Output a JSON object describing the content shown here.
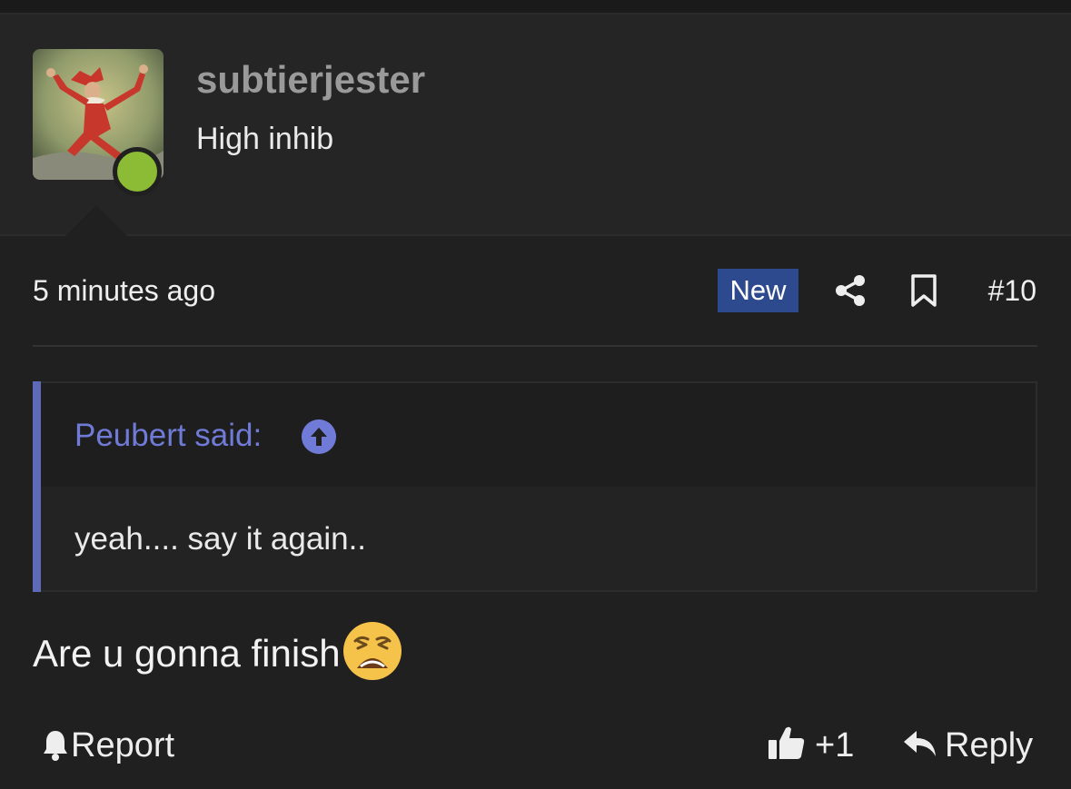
{
  "post": {
    "author": "subtierjester",
    "user_title": "High inhib",
    "timestamp": "5 minutes ago",
    "badge": "New",
    "post_number": "#10",
    "online_status_color": "#8cbb35"
  },
  "quote": {
    "author_line": "Peubert said:",
    "text": "yeah.... say it again.."
  },
  "message": {
    "text": "Are u gonna finish",
    "emoji": "weary-face-emoji"
  },
  "actions": {
    "report_label": "Report",
    "like_count": "+1",
    "reply_label": "Reply"
  },
  "icons": {
    "share": "share-icon",
    "bookmark": "bookmark-icon",
    "quote_jump": "arrow-up-circle-icon",
    "report": "bell-icon",
    "like": "thumbs-up-icon",
    "reply": "reply-arrow-icon"
  },
  "colors": {
    "background": "#202020",
    "accent": "#6f7bd6",
    "badge_bg": "#2e4a8f"
  }
}
